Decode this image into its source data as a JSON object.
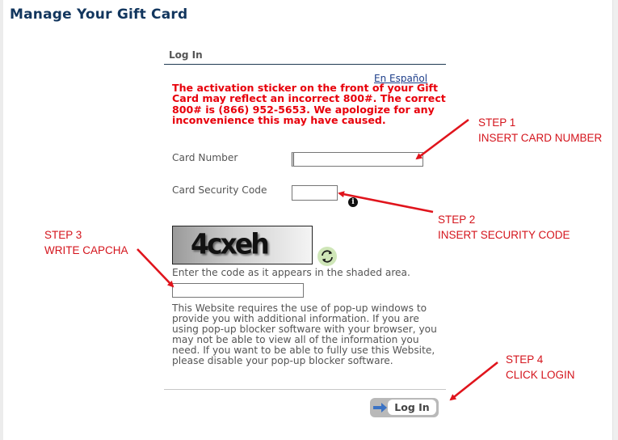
{
  "page": {
    "title": "Manage Your Gift Card"
  },
  "login": {
    "section_title": "Log In",
    "language_link": "En Español",
    "notice": "The activation sticker on the front of your Gift Card may reflect an incorrect 800#. The correct 800# is (866) 952-5653. We apologize for any inconvenience this may have caused.",
    "card_number": {
      "label": "Card Number",
      "value": "",
      "placeholder": ""
    },
    "security_code": {
      "label": "Card Security Code",
      "value": "",
      "placeholder": ""
    },
    "info_icon": "info-icon",
    "captcha": {
      "image_text": "4cxeh",
      "refresh_icon": "refresh-icon",
      "hint": "Enter the code as it appears in the shaded area.",
      "value": "",
      "placeholder": ""
    },
    "popup_note": "This Website requires the use of pop-up windows to provide you with additional information. If you are using pop-up blocker software with your browser, you may not be able to view all of the information you need. If you want to be able to fully use this Website, please disable your pop-up blocker software.",
    "login_button": {
      "label": "Log In",
      "icon": "arrow-right-icon"
    }
  },
  "annotations": {
    "color": "#d4141c",
    "steps": [
      {
        "step": "STEP 1",
        "instruction": "INSERT CARD NUMBER"
      },
      {
        "step": "STEP 2",
        "instruction": "INSERT SECURITY CODE"
      },
      {
        "step": "STEP 3",
        "instruction": "WRITE CAPCHA"
      },
      {
        "step": "STEP 4",
        "instruction": "CLICK LOGIN"
      }
    ]
  },
  "colors": {
    "title": "#12365e",
    "notice": "#e8000b",
    "link": "#1d3e8a",
    "body_text": "#555555"
  }
}
